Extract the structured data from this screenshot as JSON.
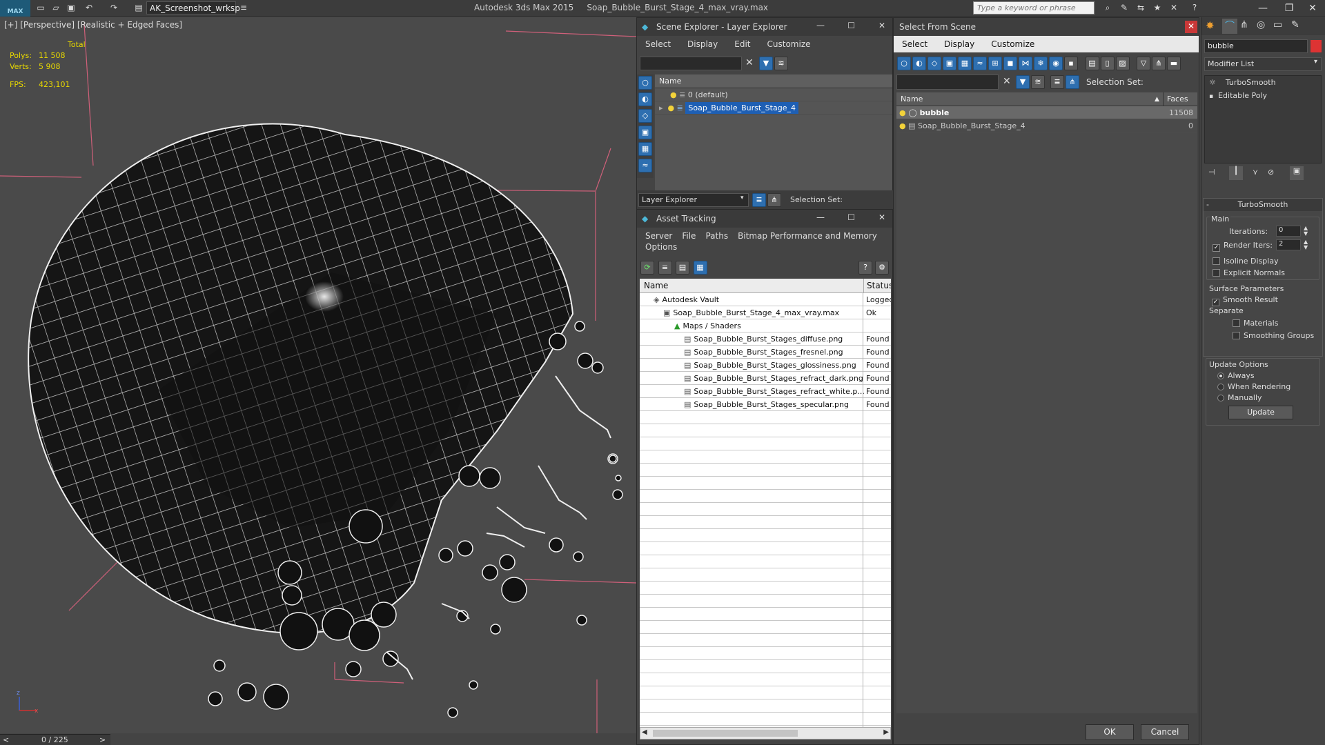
{
  "titlebar": {
    "logo": "MAX",
    "workspace": "AK_Screenshot_wrksp",
    "app_name": "Autodesk 3ds Max  2015",
    "file_name": "Soap_Bubble_Burst_Stage_4_max_vray.max",
    "search_placeholder": "Type a keyword or phrase"
  },
  "viewport": {
    "label": "[+] [Perspective] [Realistic + Edged Faces]",
    "stats": {
      "total_label": "Total",
      "polys_label": "Polys:",
      "polys_value": "11 508",
      "verts_label": "Verts:",
      "verts_value": "5 908",
      "fps_label": "FPS:",
      "fps_value": "423,101"
    },
    "timeline": "0 / 225",
    "timeline_prev": "<",
    "timeline_next": ">"
  },
  "scene_explorer": {
    "title": "Scene Explorer - Layer Explorer",
    "menu": [
      "Select",
      "Display",
      "Edit",
      "Customize"
    ],
    "column": "Name",
    "layers": [
      "0 (default)",
      "Soap_Bubble_Burst_Stage_4"
    ],
    "footer_dropdown": "Layer Explorer",
    "selection_set_label": "Selection Set:"
  },
  "asset_tracking": {
    "title": "Asset Tracking",
    "menu": [
      "Server",
      "File",
      "Paths",
      "Bitmap Performance and Memory"
    ],
    "menu2": "Options",
    "col_name": "Name",
    "col_status": "Status",
    "rows": [
      {
        "name": "Autodesk Vault",
        "status": "Logged"
      },
      {
        "name": "Soap_Bubble_Burst_Stage_4_max_vray.max",
        "status": "Ok"
      },
      {
        "name": "Maps / Shaders",
        "status": ""
      },
      {
        "name": "Soap_Bubble_Burst_Stages_diffuse.png",
        "status": "Found"
      },
      {
        "name": "Soap_Bubble_Burst_Stages_fresnel.png",
        "status": "Found"
      },
      {
        "name": "Soap_Bubble_Burst_Stages_glossiness.png",
        "status": "Found"
      },
      {
        "name": "Soap_Bubble_Burst_Stages_refract_dark.png",
        "status": "Found"
      },
      {
        "name": "Soap_Bubble_Burst_Stages_refract_white.p...",
        "status": "Found"
      },
      {
        "name": "Soap_Bubble_Burst_Stages_specular.png",
        "status": "Found"
      }
    ]
  },
  "select_from_scene": {
    "title": "Select From Scene",
    "menu": [
      "Select",
      "Display",
      "Customize"
    ],
    "selection_set_label": "Selection Set:",
    "col_name": "Name",
    "col_faces": "Faces",
    "rows": [
      {
        "name": "bubble",
        "faces": "11508"
      },
      {
        "name": "Soap_Bubble_Burst_Stage_4",
        "faces": "0"
      }
    ],
    "ok": "OK",
    "cancel": "Cancel"
  },
  "command_panel": {
    "object_name": "bubble",
    "modifier_list": "Modifier List",
    "stack": [
      "TurboSmooth",
      "Editable Poly"
    ],
    "rollout_title": "TurboSmooth",
    "main_label": "Main",
    "iterations_label": "Iterations:",
    "iterations_value": "0",
    "render_iters_label": "Render Iters:",
    "render_iters_value": "2",
    "isoline": "Isoline Display",
    "explicit_normals": "Explicit Normals",
    "surface_params": "Surface Parameters",
    "smooth_result": "Smooth Result",
    "separate": "Separate",
    "materials": "Materials",
    "smoothing_groups": "Smoothing Groups",
    "update_options": "Update Options",
    "always": "Always",
    "when_rendering": "When Rendering",
    "manually": "Manually",
    "update_button": "Update",
    "accent": "#1e5fb4"
  }
}
